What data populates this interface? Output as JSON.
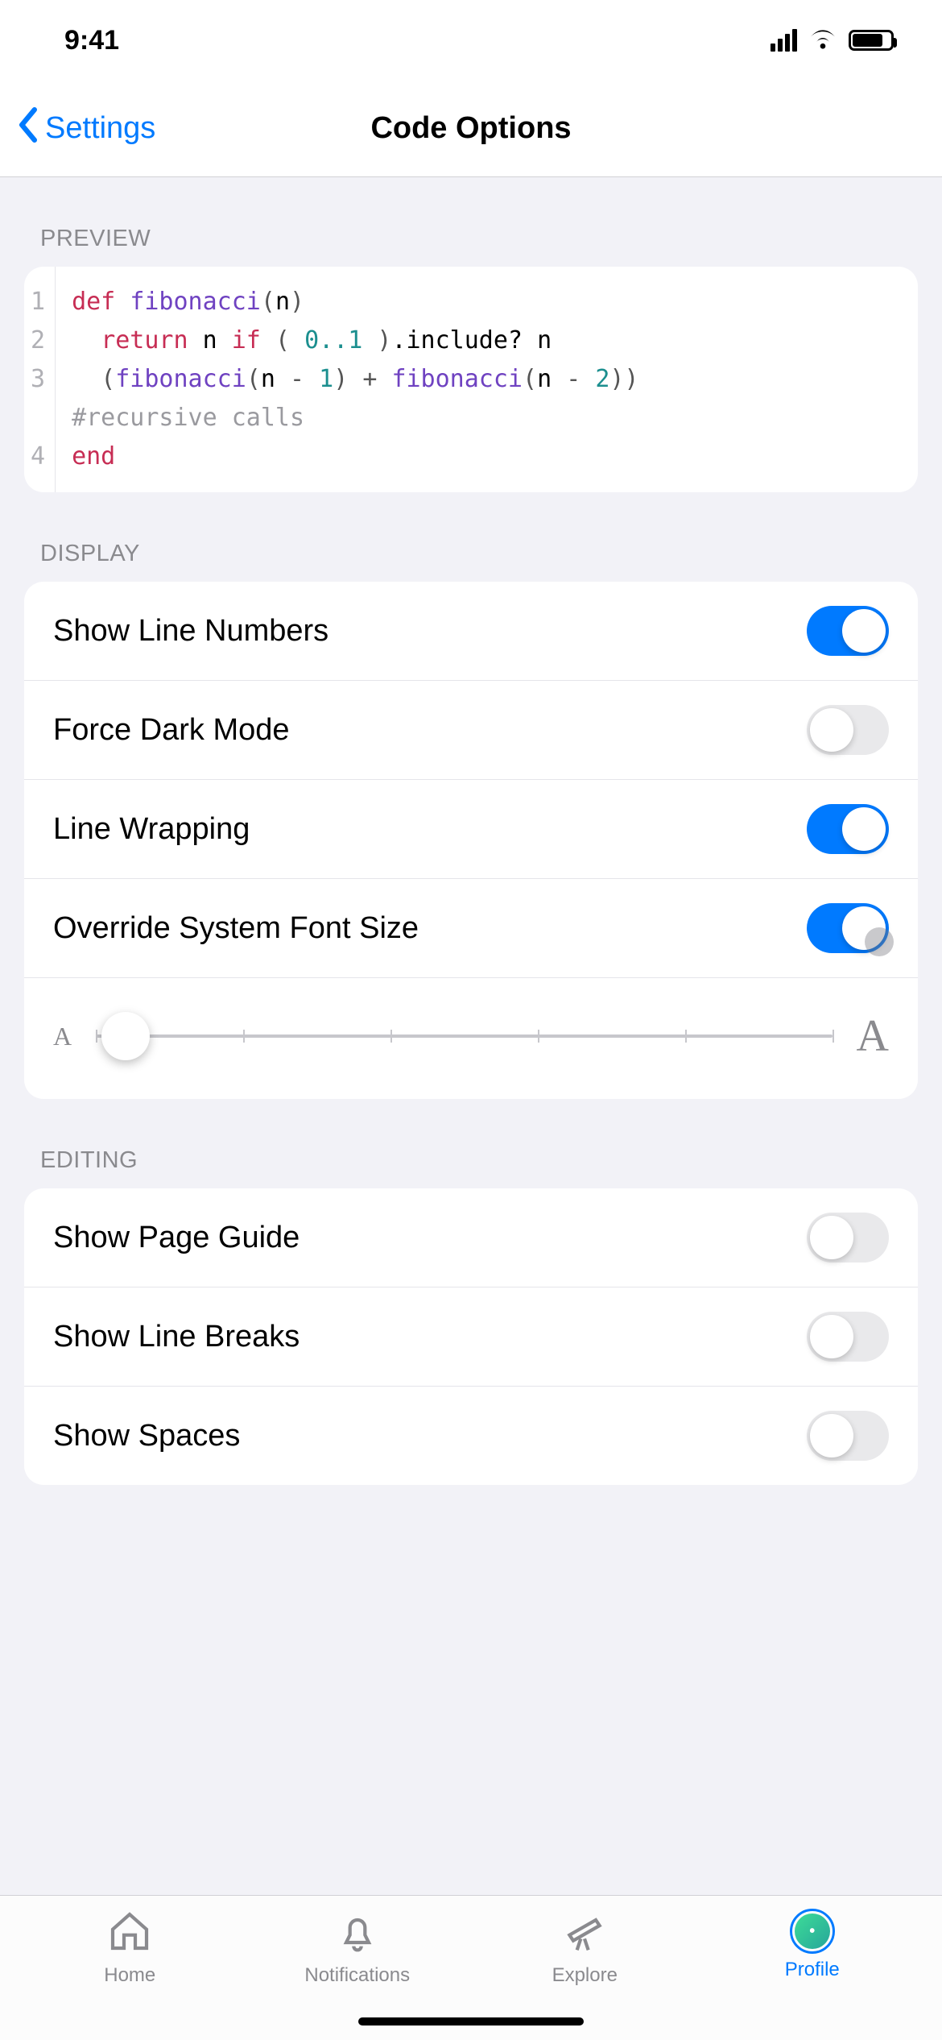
{
  "status": {
    "time": "9:41"
  },
  "nav": {
    "back": "Settings",
    "title": "Code Options"
  },
  "sections": {
    "preview": "PREVIEW",
    "display": "DISPLAY",
    "editing": "EDITING"
  },
  "code": {
    "gutter": "1\n2\n3\n\n4",
    "tokens": {
      "def": "def",
      "fnname": "fibonacci",
      "lp": "(",
      "n": "n",
      "rp": ")",
      "return": "return",
      "if": "if",
      "range": "0..1",
      "include": ".include?",
      "minus1": "1",
      "plus": "+",
      "minus2": "2",
      "comment": "#recursive calls",
      "end": "end"
    }
  },
  "display": {
    "lineNumbers": {
      "label": "Show Line Numbers",
      "on": true
    },
    "darkMode": {
      "label": "Force Dark Mode",
      "on": false
    },
    "wrapping": {
      "label": "Line Wrapping",
      "on": true
    },
    "fontSize": {
      "label": "Override System Font Size",
      "on": true
    },
    "slider": {
      "small": "A",
      "large": "A",
      "value": 0,
      "ticks": 6
    }
  },
  "editing": {
    "pageGuide": {
      "label": "Show Page Guide",
      "on": false
    },
    "lineBreaks": {
      "label": "Show Line Breaks",
      "on": false
    },
    "spaces": {
      "label": "Show Spaces",
      "on": false
    }
  },
  "tabs": {
    "home": "Home",
    "notifications": "Notifications",
    "explore": "Explore",
    "profile": "Profile"
  }
}
